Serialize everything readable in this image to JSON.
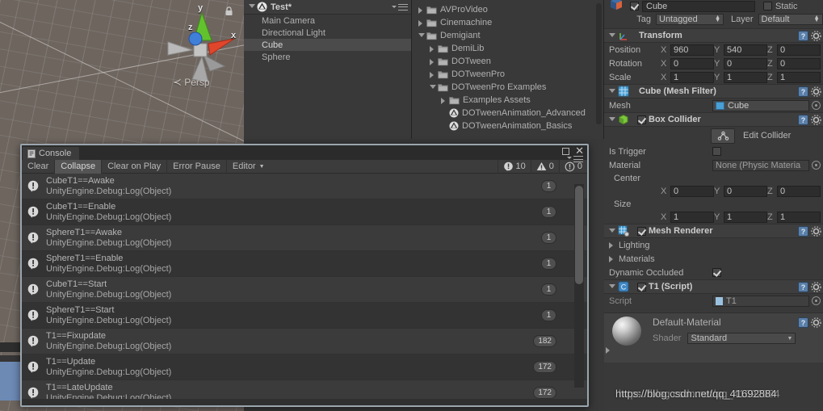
{
  "scene_view": {
    "projection_label": "Persp",
    "gizmo_axes": [
      "y",
      "z",
      "x"
    ],
    "lock_icon": "lock-icon"
  },
  "hierarchy": {
    "scene_name": "Test*",
    "items": [
      {
        "label": "Main Camera",
        "selected": false
      },
      {
        "label": "Directional Light",
        "selected": false
      },
      {
        "label": "Cube",
        "selected": true
      },
      {
        "label": "Sphere",
        "selected": false
      }
    ]
  },
  "project": {
    "items": [
      {
        "label": "AVProVideo",
        "indent": 0,
        "type": "folder",
        "expanded": false
      },
      {
        "label": "Cinemachine",
        "indent": 0,
        "type": "folder",
        "expanded": false
      },
      {
        "label": "Demigiant",
        "indent": 0,
        "type": "folder",
        "expanded": true
      },
      {
        "label": "DemiLib",
        "indent": 1,
        "type": "folder",
        "expanded": false
      },
      {
        "label": "DOTween",
        "indent": 1,
        "type": "folder",
        "expanded": false
      },
      {
        "label": "DOTweenPro",
        "indent": 1,
        "type": "folder",
        "expanded": false
      },
      {
        "label": "DOTweenPro Examples",
        "indent": 1,
        "type": "folder",
        "expanded": true
      },
      {
        "label": "Examples Assets",
        "indent": 2,
        "type": "folder",
        "expanded": false
      },
      {
        "label": "DOTweenAnimation_Advanced",
        "indent": 2,
        "type": "scene",
        "expanded": null
      },
      {
        "label": "DOTweenAnimation_Basics",
        "indent": 2,
        "type": "scene",
        "expanded": null
      }
    ]
  },
  "inspector": {
    "object_name": "Cube",
    "object_enabled": true,
    "static_label": "Static",
    "static_checked": false,
    "tag_label": "Tag",
    "tag_value": "Untagged",
    "layer_label": "Layer",
    "layer_value": "Default",
    "transform": {
      "title": "Transform",
      "rows": [
        {
          "label": "Position",
          "x": "960",
          "y": "540",
          "z": "0"
        },
        {
          "label": "Rotation",
          "x": "0",
          "y": "0",
          "z": "0"
        },
        {
          "label": "Scale",
          "x": "1",
          "y": "1",
          "z": "1"
        }
      ],
      "axis_labels": [
        "X",
        "Y",
        "Z"
      ]
    },
    "mesh_filter": {
      "title": "Cube (Mesh Filter)",
      "mesh_label": "Mesh",
      "mesh_value": "Cube"
    },
    "box_collider": {
      "title": "Box Collider",
      "enabled": true,
      "edit_collider_label": "Edit Collider",
      "is_trigger_label": "Is Trigger",
      "is_trigger_checked": false,
      "material_label": "Material",
      "material_value": "None (Physic Materia",
      "center_label": "Center",
      "center": {
        "x": "0",
        "y": "0",
        "z": "0"
      },
      "size_label": "Size",
      "size": {
        "x": "1",
        "y": "1",
        "z": "1"
      }
    },
    "mesh_renderer": {
      "title": "Mesh Renderer",
      "enabled": true,
      "lighting_label": "Lighting",
      "materials_label": "Materials",
      "dynamic_occluded_label": "Dynamic Occluded",
      "dynamic_occluded_checked": true
    },
    "script_component": {
      "title": "T1 (Script)",
      "enabled": true,
      "script_label": "Script",
      "script_value": "T1"
    },
    "material": {
      "title": "Default-Material",
      "shader_label": "Shader",
      "shader_value": "Standard"
    }
  },
  "console": {
    "tab_label": "Console",
    "toolbar": {
      "clear": "Clear",
      "collapse": "Collapse",
      "clear_on_play": "Clear on Play",
      "error_pause": "Error Pause",
      "editor": "Editor"
    },
    "counts": {
      "log": "10",
      "warning": "0",
      "error": "0"
    },
    "entries": [
      {
        "message": "CubeT1==Awake",
        "stack": "UnityEngine.Debug:Log(Object)",
        "count": "1"
      },
      {
        "message": "CubeT1==Enable",
        "stack": "UnityEngine.Debug:Log(Object)",
        "count": "1"
      },
      {
        "message": "SphereT1==Awake",
        "stack": "UnityEngine.Debug:Log(Object)",
        "count": "1"
      },
      {
        "message": "SphereT1==Enable",
        "stack": "UnityEngine.Debug:Log(Object)",
        "count": "1"
      },
      {
        "message": "CubeT1==Start",
        "stack": "UnityEngine.Debug:Log(Object)",
        "count": "1"
      },
      {
        "message": "SphereT1==Start",
        "stack": "UnityEngine.Debug:Log(Object)",
        "count": "1"
      },
      {
        "message": "T1==Fixupdate",
        "stack": "UnityEngine.Debug:Log(Object)",
        "count": "182"
      },
      {
        "message": "T1==Update",
        "stack": "UnityEngine.Debug:Log(Object)",
        "count": "172"
      },
      {
        "message": "T1==LateUpdate",
        "stack": "UnityEngine.Debug:Log(Object)",
        "count": "172"
      }
    ]
  },
  "watermark": "https://blog.csdn.net/qq_41692884"
}
